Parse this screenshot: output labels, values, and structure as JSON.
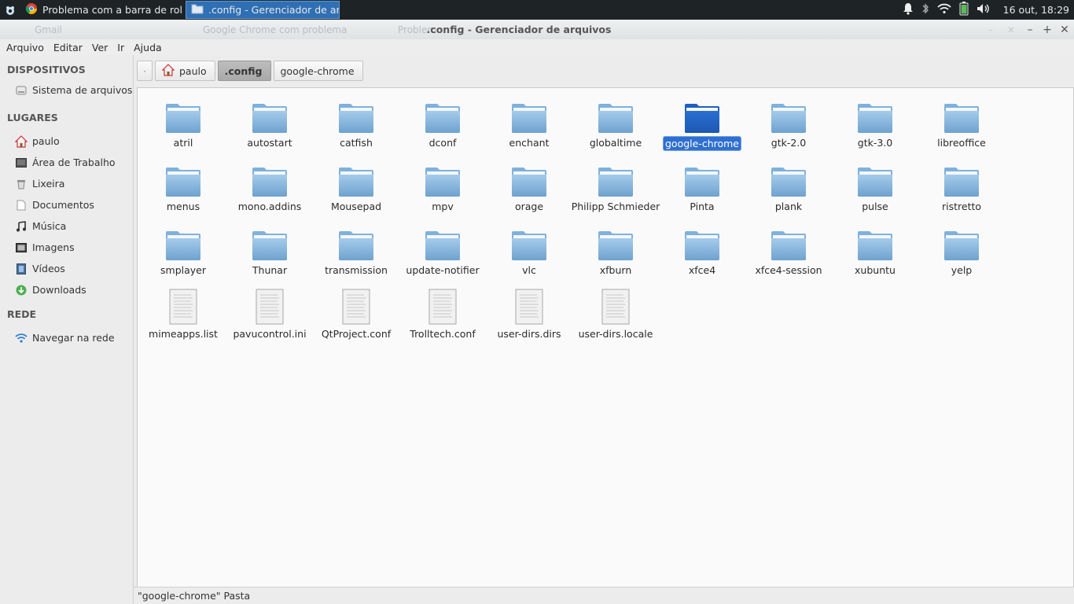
{
  "panel": {
    "tasks": [
      {
        "label": "Problema com a barra de rol..."
      },
      {
        "label": ".config - Gerenciador de arq..."
      }
    ],
    "clock": "16 out, 18:29"
  },
  "titlebar": {
    "title": ".config - Gerenciador de arquivos",
    "ghost_tabs": [
      "Gmail",
      "Google Chrome com problema",
      "Problem"
    ]
  },
  "menubar": [
    "Arquivo",
    "Editar",
    "Ver",
    "Ir",
    "Ajuda"
  ],
  "sidebar": {
    "devices_header": "DISPOSITIVOS",
    "devices": [
      {
        "label": "Sistema de arquivos",
        "icon": "drive-icon"
      }
    ],
    "places_header": "LUGARES",
    "places": [
      {
        "label": "paulo",
        "icon": "home-icon"
      },
      {
        "label": "Área de Trabalho",
        "icon": "desktop-icon"
      },
      {
        "label": "Lixeira",
        "icon": "trash-icon"
      },
      {
        "label": "Documentos",
        "icon": "document-icon"
      },
      {
        "label": "Música",
        "icon": "music-icon"
      },
      {
        "label": "Imagens",
        "icon": "image-icon"
      },
      {
        "label": "Vídeos",
        "icon": "video-icon"
      },
      {
        "label": "Downloads",
        "icon": "download-icon"
      }
    ],
    "network_header": "REDE",
    "network": [
      {
        "label": "Navegar na rede",
        "icon": "network-icon"
      }
    ]
  },
  "pathbar": {
    "home": "paulo",
    "current": ".config",
    "next": "google-chrome"
  },
  "items": [
    {
      "name": "atril",
      "type": "folder"
    },
    {
      "name": "autostart",
      "type": "folder"
    },
    {
      "name": "catfish",
      "type": "folder"
    },
    {
      "name": "dconf",
      "type": "folder"
    },
    {
      "name": "enchant",
      "type": "folder"
    },
    {
      "name": "globaltime",
      "type": "folder"
    },
    {
      "name": "google-chrome",
      "type": "folder",
      "selected": true
    },
    {
      "name": "gtk-2.0",
      "type": "folder"
    },
    {
      "name": "gtk-3.0",
      "type": "folder"
    },
    {
      "name": "libreoffice",
      "type": "folder"
    },
    {
      "name": "menus",
      "type": "folder"
    },
    {
      "name": "mono.addins",
      "type": "folder"
    },
    {
      "name": "Mousepad",
      "type": "folder"
    },
    {
      "name": "mpv",
      "type": "folder"
    },
    {
      "name": "orage",
      "type": "folder"
    },
    {
      "name": "Philipp Schmieder",
      "type": "folder"
    },
    {
      "name": "Pinta",
      "type": "folder"
    },
    {
      "name": "plank",
      "type": "folder"
    },
    {
      "name": "pulse",
      "type": "folder"
    },
    {
      "name": "ristretto",
      "type": "folder"
    },
    {
      "name": "smplayer",
      "type": "folder"
    },
    {
      "name": "Thunar",
      "type": "folder"
    },
    {
      "name": "transmission",
      "type": "folder"
    },
    {
      "name": "update-notifier",
      "type": "folder"
    },
    {
      "name": "vlc",
      "type": "folder"
    },
    {
      "name": "xfburn",
      "type": "folder"
    },
    {
      "name": "xfce4",
      "type": "folder"
    },
    {
      "name": "xfce4-session",
      "type": "folder"
    },
    {
      "name": "xubuntu",
      "type": "folder"
    },
    {
      "name": "yelp",
      "type": "folder"
    },
    {
      "name": "mimeapps.list",
      "type": "file"
    },
    {
      "name": "pavucontrol.ini",
      "type": "file"
    },
    {
      "name": "QtProject.conf",
      "type": "file"
    },
    {
      "name": "Trolltech.conf",
      "type": "file"
    },
    {
      "name": "user-dirs.dirs",
      "type": "file"
    },
    {
      "name": "user-dirs.locale",
      "type": "file"
    }
  ],
  "status": "\"google-chrome\" Pasta",
  "colors": {
    "accent": "#2f6fd0",
    "folder": "#6ea8d8",
    "selected_folder": "#1f5fc0"
  }
}
